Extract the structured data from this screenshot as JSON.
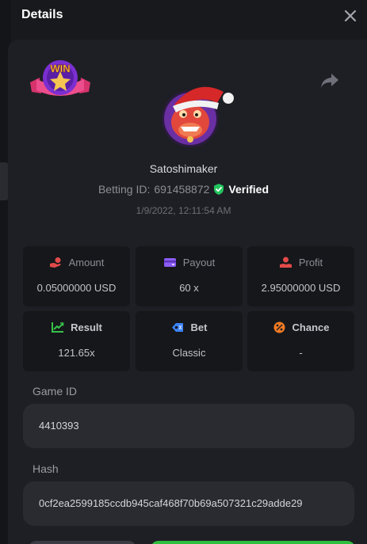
{
  "header": {
    "title": "Details"
  },
  "badge": {
    "text": "WIN"
  },
  "player": {
    "username": "Satoshimaker",
    "betting_id_label": "Betting ID:",
    "betting_id": "691458872",
    "verified_label": "Verified",
    "timestamp": "1/9/2022, 12:11:54 AM"
  },
  "stats": {
    "amount": {
      "label": "Amount",
      "value": "0.05000000 USD"
    },
    "payout": {
      "label": "Payout",
      "value": "60 x"
    },
    "profit": {
      "label": "Profit",
      "value": "2.95000000 USD"
    },
    "result": {
      "label": "Result",
      "value": "121.65x"
    },
    "bet": {
      "label": "Bet",
      "value": "Classic"
    },
    "chance": {
      "label": "Chance",
      "value": "-"
    }
  },
  "fields": {
    "game_id_label": "Game ID",
    "game_id_value": "4410393",
    "hash_label": "Hash",
    "hash_value": "0cf2ea2599185ccdb945caf468f70b69a507321c29adde29"
  },
  "colors": {
    "panel_bg": "#1e1f24",
    "card_bg": "#16171a",
    "field_bg": "#2a2b31",
    "verified_green": "#22c55e",
    "payout_purple": "#8b5cf6",
    "profit_red": "#e24a4a",
    "result_green": "#36c24a",
    "bet_blue": "#3b82f6",
    "chance_orange": "#f07a22",
    "action_green": "#2fbf3f"
  },
  "icons": {
    "close": "close-icon",
    "share": "share-icon",
    "verified": "shield-check-icon",
    "amount": "hand-coin-icon",
    "payout": "wallet-icon",
    "profit": "hand-money-icon",
    "result": "chart-up-icon",
    "bet": "tag-icon",
    "chance": "percent-icon"
  }
}
